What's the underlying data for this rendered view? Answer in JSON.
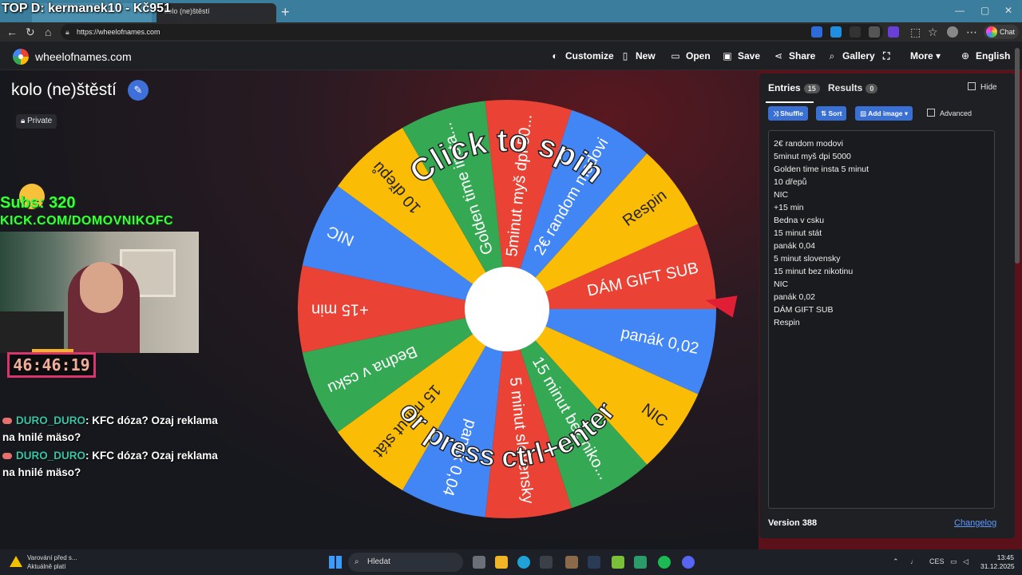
{
  "stream_overlay": {
    "top_donation": "TOP D: kermanek10 - Kč951",
    "subs": "Subs: 320",
    "kick_url": "KICK.COM/DOMOVNIKOFC",
    "timer": "46:46:19"
  },
  "browser": {
    "tab_title": "kolo (ne)štěstí",
    "url": "https://wheelofnames.com",
    "chat_label": "Chat"
  },
  "header": {
    "brand": "wheelofnames.com",
    "menu": {
      "customize": "Customize",
      "new": "New",
      "open": "Open",
      "save": "Save",
      "share": "Share",
      "gallery": "Gallery",
      "more": "More",
      "language": "English"
    }
  },
  "wheel": {
    "title": "kolo (ne)štěstí",
    "visibility": "Private",
    "prompt_top": "Click to spin",
    "prompt_bottom": "or press ctrl+enter",
    "colors": [
      "#ea4335",
      "#4285f4",
      "#fbbc05",
      "#34a853"
    ],
    "segments": [
      "DÁM GIFT SUB",
      "panák 0,02",
      "NIC",
      "15 minut bez niko...",
      "5 minut slovensky",
      "panák 0,04",
      "15 minut stát",
      "Bedna v csku",
      "+15 min",
      "NIC",
      "10 dřepů",
      "Golden time insta...",
      "5minut myš dpi 50...",
      "2€ random modovi",
      "Respin"
    ]
  },
  "panel": {
    "tab_entries": "Entries",
    "entries_count": "15",
    "tab_results": "Results",
    "results_count": "0",
    "hide_label": "Hide",
    "shuffle": "Shuffle",
    "sort": "Sort",
    "add_image": "Add image",
    "advanced": "Advanced",
    "entries": [
      "2€ random modovi",
      "5minut myš dpi 5000",
      "Golden time insta 5 minut",
      "10 dřepů",
      "NIC",
      "+15 min",
      "Bedna v csku",
      "15 minut stát",
      "panák 0,04",
      "5 minut slovensky",
      "15 minut bez nikotinu",
      "NIC",
      "panák 0,02",
      "DÁM GIFT SUB",
      "Respin"
    ],
    "version": "Version 388",
    "changelog": "Changelog"
  },
  "chat": [
    {
      "user": "DURO_DURO",
      "text": ": KFC dóza? Ozaj reklama na hnilé mäso?"
    },
    {
      "user": "DURO_DURO",
      "text": ": KFC dóza? Ozaj reklama na hnilé mäso?"
    }
  ],
  "taskbar": {
    "warning_title": "Varování před s...",
    "warning_sub": "Aktuálně platí",
    "search": "Hledat",
    "lang": "CES",
    "time": "13:45",
    "date": "31.12.2025"
  }
}
